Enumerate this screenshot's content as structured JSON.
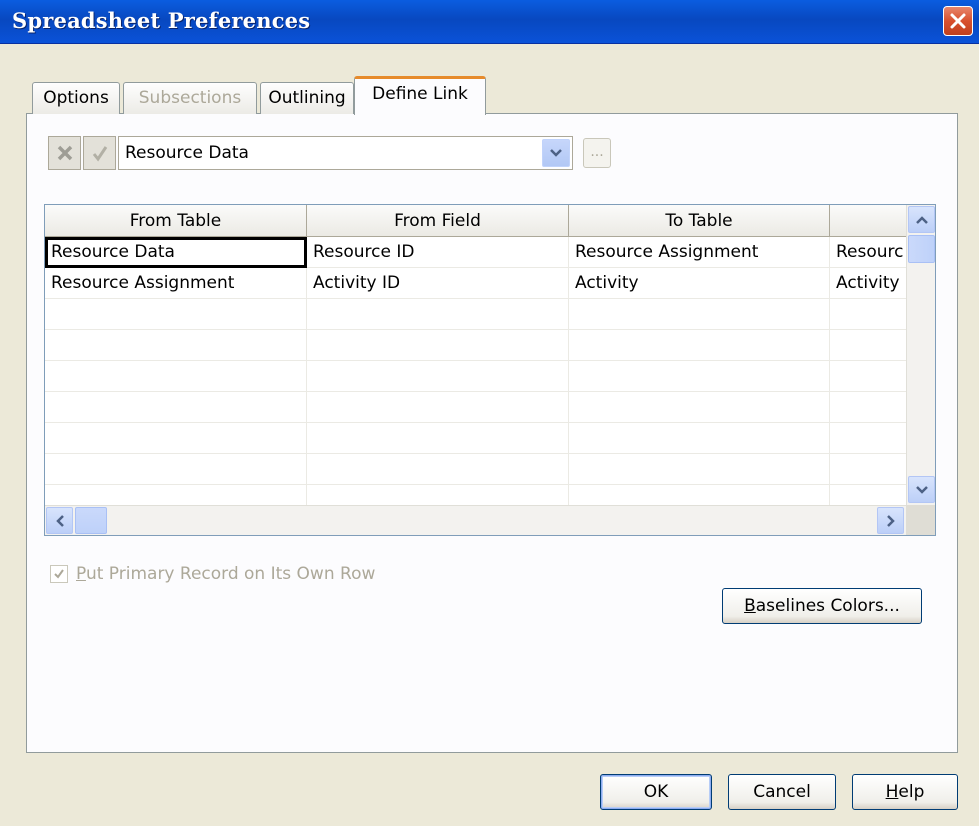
{
  "window": {
    "title": "Spreadsheet Preferences"
  },
  "tabs": [
    {
      "label": "Options",
      "state": "normal"
    },
    {
      "label": "Subsections",
      "state": "disabled"
    },
    {
      "label": "Outlining",
      "state": "normal"
    },
    {
      "label": "Define Link",
      "state": "active"
    }
  ],
  "link_selector": {
    "cancel_icon": "x-icon",
    "confirm_icon": "check-icon",
    "selected_value": "Resource Data",
    "ellipsis_label": "..."
  },
  "grid": {
    "columns": [
      "From Table",
      "From Field",
      "To Table",
      ""
    ],
    "rows": [
      [
        "Resource Data",
        "Resource ID",
        "Resource Assignment",
        "Resourc"
      ],
      [
        "Resource Assignment",
        "Activity ID",
        "Activity",
        "Activity"
      ]
    ]
  },
  "put_primary": {
    "checked": true,
    "label_pre": "",
    "label_underline": "P",
    "label_post": "ut Primary Record on Its Own Row"
  },
  "baselines": {
    "label_underline": "B",
    "label_post": "aselines Colors..."
  },
  "footer": {
    "ok": "OK",
    "cancel": "Cancel",
    "help_underline": "H",
    "help_post": "elp"
  },
  "colors": {
    "title_bar": "#0a52d8",
    "active_tab_accent": "#e68b2c",
    "close_button": "#d8502e"
  }
}
